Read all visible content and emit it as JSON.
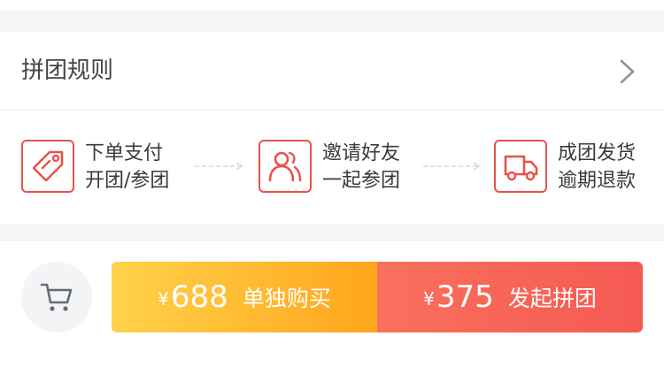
{
  "rules": {
    "title": "拼团规则",
    "steps": [
      {
        "line1": "下单支付",
        "line2": "开团/参团",
        "icon": "price-tag-icon"
      },
      {
        "line1": "邀请好友",
        "line2": "一起参团",
        "icon": "users-icon"
      },
      {
        "line1": "成团发货",
        "line2": "逾期退款",
        "icon": "delivery-truck-icon"
      }
    ]
  },
  "bottom_bar": {
    "cart_icon": "shopping-cart-icon",
    "solo": {
      "currency": "¥",
      "price": "688",
      "label": "单独购买"
    },
    "group": {
      "currency": "¥",
      "price": "375",
      "label": "发起拼团"
    }
  },
  "colors": {
    "accent": "#e8524a",
    "solo_gradient": [
      "#ffd24a",
      "#ffa51c"
    ],
    "group_gradient": [
      "#f9705d",
      "#f55a52"
    ],
    "background": "#f5f6f8"
  }
}
